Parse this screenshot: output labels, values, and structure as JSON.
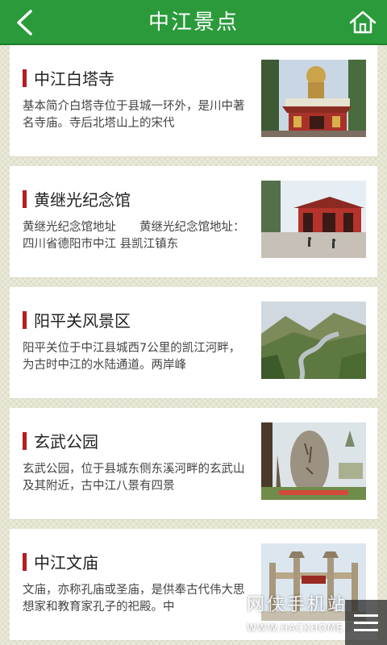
{
  "header": {
    "title": "中江景点",
    "back_icon": "chevron-left-icon",
    "home_icon": "home-icon",
    "bar_color": "#2a9a3a"
  },
  "attractions": [
    {
      "name": "中江白塔寺",
      "description": "基本简介白塔寺位于县城一环外，是川中著名寺庙。寺后北塔山上的宋代",
      "image": "temple with golden buddha statue"
    },
    {
      "name": "黄继光纪念馆",
      "description": "黄继光纪念馆地址　　黄继光纪念馆地址：四川省德阳市中江 县凯江镇东",
      "image": "red memorial hall gate"
    },
    {
      "name": "阳平关风景区",
      "description": "阳平关位于中江县城西7公里的凯江河畔，为古时中江的水陆通道。两岸峰",
      "image": "river valley among mountains"
    },
    {
      "name": "玄武公园",
      "description": "玄武公园，位于县城东侧东溪河畔的玄武山及其附近，古中江八景有四景",
      "image": "carved stone in park"
    },
    {
      "name": "中江文庙",
      "description": "文庙，亦称孔庙或圣庙，是供奉古代伟大思想家和教育家孔子的祀殿。中",
      "image": "stone archway of temple"
    }
  ],
  "watermark": {
    "logo_text": "网侠手机站",
    "url": "WWW.HACKHOME.COM"
  },
  "menu": {
    "icon": "hamburger-menu-icon"
  },
  "colors": {
    "accent_bar": "#b51c24",
    "background": "#ecebd9"
  }
}
